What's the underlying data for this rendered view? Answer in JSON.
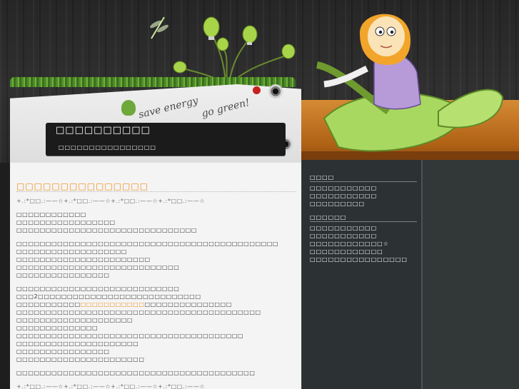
{
  "header": {
    "slogan_line1": "save energy",
    "slogan_line2": "go green!",
    "site_title": "□□□□□□□□□□",
    "site_description": "□□□□□□□□□□□□□□□□"
  },
  "post": {
    "title": "□□□□□□□□□□□□□□□",
    "divider_top": "+.:*□□.:——☆+.:*□□.:——☆+.:*□□.:——☆+.:*□□.:——☆",
    "paragraphs": [
      [
        "□□□□□□□□□□□□",
        "□□□□□□□□□□□□□□□□□",
        "□□□□□□□□□□□□□□□□□□□□□□□□□□□□□□□"
      ],
      [
        "□□□□□□□□□□□□□□□□□□□□□□□□□□□□□□□□□□□□□□□□□□□□□",
        "□□□□□□□□□□□□□□□□□□□",
        "□□□□□□□□□□□□□□□□□□□□□□□",
        "□□□□□□□□□□□□□□□□□□□□□□□□□□□□",
        "□□□□□□□□□□□□□□□□"
      ],
      [
        "□□□□□□□□□□□□□□□□□□□□□□□□□□□□",
        "□□□2□□□□□□□□□□□□□□□□□□□□□□□□□□□□"
      ],
      [
        "□□□□□□□□□□□□□□□□□□□□□□□□□□□□□□□□□□□□□□□□□□",
        "□□□□□□□□□□□□□□□□□□□□",
        "□□□□□□□□□□□□□□",
        "□□□□□□□□□□□□□□□□□□□□□□□□□□□□□□□□□□□□□□□",
        "□□□□□□□□□□□□□□□□□□□□□",
        "□□□□□□□□□□□□□□□□",
        "□□□□□□□□□□□□□□□□□□□□□□"
      ],
      [
        "□□□□□□□□□□□□□□□□□□□□□□□□□□□□□□□□□□□□□□□□□"
      ]
    ],
    "highlight_prefix": "□□□□□□□□□□□",
    "highlight_text": "□□□□□□□□□□□",
    "highlight_suffix": "□□□□□□□□□□□□□□□",
    "divider_bottom": "+.:*□□.:——☆+.:*□□.:——☆+.:*□□.:——☆+.:*□□.:——☆"
  },
  "sidebar": {
    "widget1": {
      "title": "□□□□",
      "items": [
        "□□□□□□□□□□□",
        "□□□□□□□□□□□",
        "□□□□□□□□□"
      ]
    },
    "widget2": {
      "title": "□□□□□□",
      "items": [
        "□□□□□□□□□□□",
        "□□□□□□□□□□□",
        "□□□□□□□□□□□□☆",
        "□□□□□□□□□□□□",
        "□□□□□□□□□□□□□□□□"
      ]
    }
  },
  "colors": {
    "accent_orange": "#f18c14",
    "sidebar_bg": "#2c3133",
    "content_bg": "#f4f4f4"
  }
}
